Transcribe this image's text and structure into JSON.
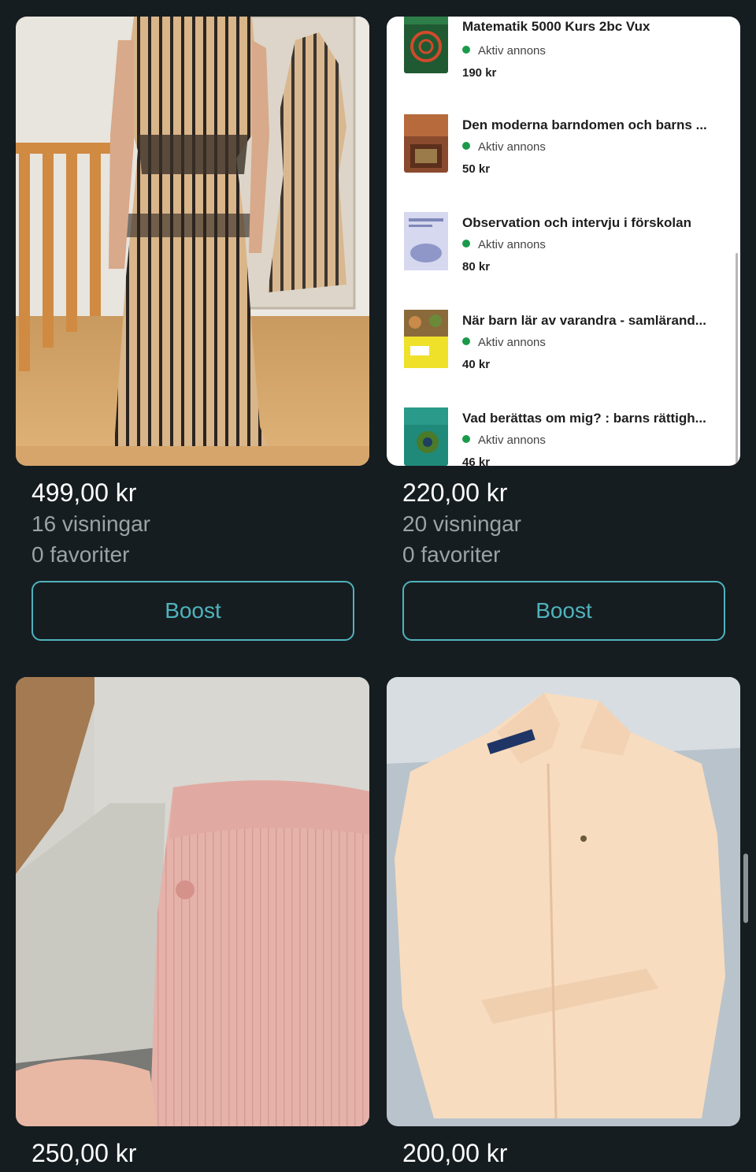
{
  "listings": [
    {
      "price": "499,00 kr",
      "views": "16 visningar",
      "favorites": "0 favoriter",
      "boost_label": "Boost"
    },
    {
      "price": "220,00 kr",
      "views": "20 visningar",
      "favorites": "0 favoriter",
      "boost_label": "Boost"
    },
    {
      "price": "250,00 kr"
    },
    {
      "price": "200,00 kr"
    }
  ],
  "books": [
    {
      "title": "Matematik 5000 Kurs 2bc Vux",
      "status": "Aktiv annons",
      "price": "190 kr"
    },
    {
      "title": "Den moderna barndomen och barns ...",
      "status": "Aktiv annons",
      "price": "50 kr"
    },
    {
      "title": "Observation och intervju i förskolan",
      "status": "Aktiv annons",
      "price": "80 kr"
    },
    {
      "title": "När barn lär av varandra - samlärand...",
      "status": "Aktiv annons",
      "price": "40 kr"
    },
    {
      "title": "Vad berättas om mig? : barns rättigh...",
      "status": "Aktiv annons",
      "price": "46 kr"
    }
  ],
  "colors": {
    "background": "#161d20",
    "accent": "#4fb3bd",
    "active_dot": "#1a9a49"
  }
}
